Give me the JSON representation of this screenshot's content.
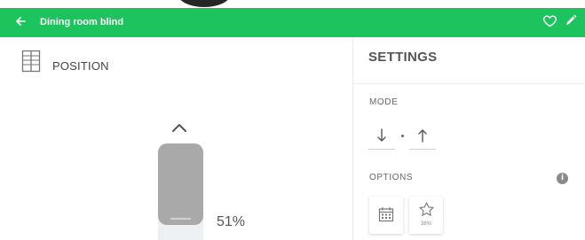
{
  "appbar": {
    "title": "Dining room blind",
    "back_icon": "arrow-left-icon",
    "favorite_icon": "heart-outline-icon",
    "edit_icon": "pencil-icon",
    "color": "#1dc35c"
  },
  "position": {
    "title": "POSITION",
    "icon": "window-blind-icon",
    "value_label": "51%",
    "level": 0.51,
    "up_icon": "chevron-up-icon"
  },
  "settings": {
    "title": "SETTINGS",
    "mode": {
      "label": "MODE",
      "down_icon": "arrow-down-icon",
      "up_icon": "arrow-up-icon"
    },
    "options": {
      "label": "OPTIONS",
      "info_icon": "info-icon",
      "schedule_icon": "calendar-icon",
      "favorite_icon": "star-outline-icon",
      "favorite_value": "38%"
    }
  }
}
